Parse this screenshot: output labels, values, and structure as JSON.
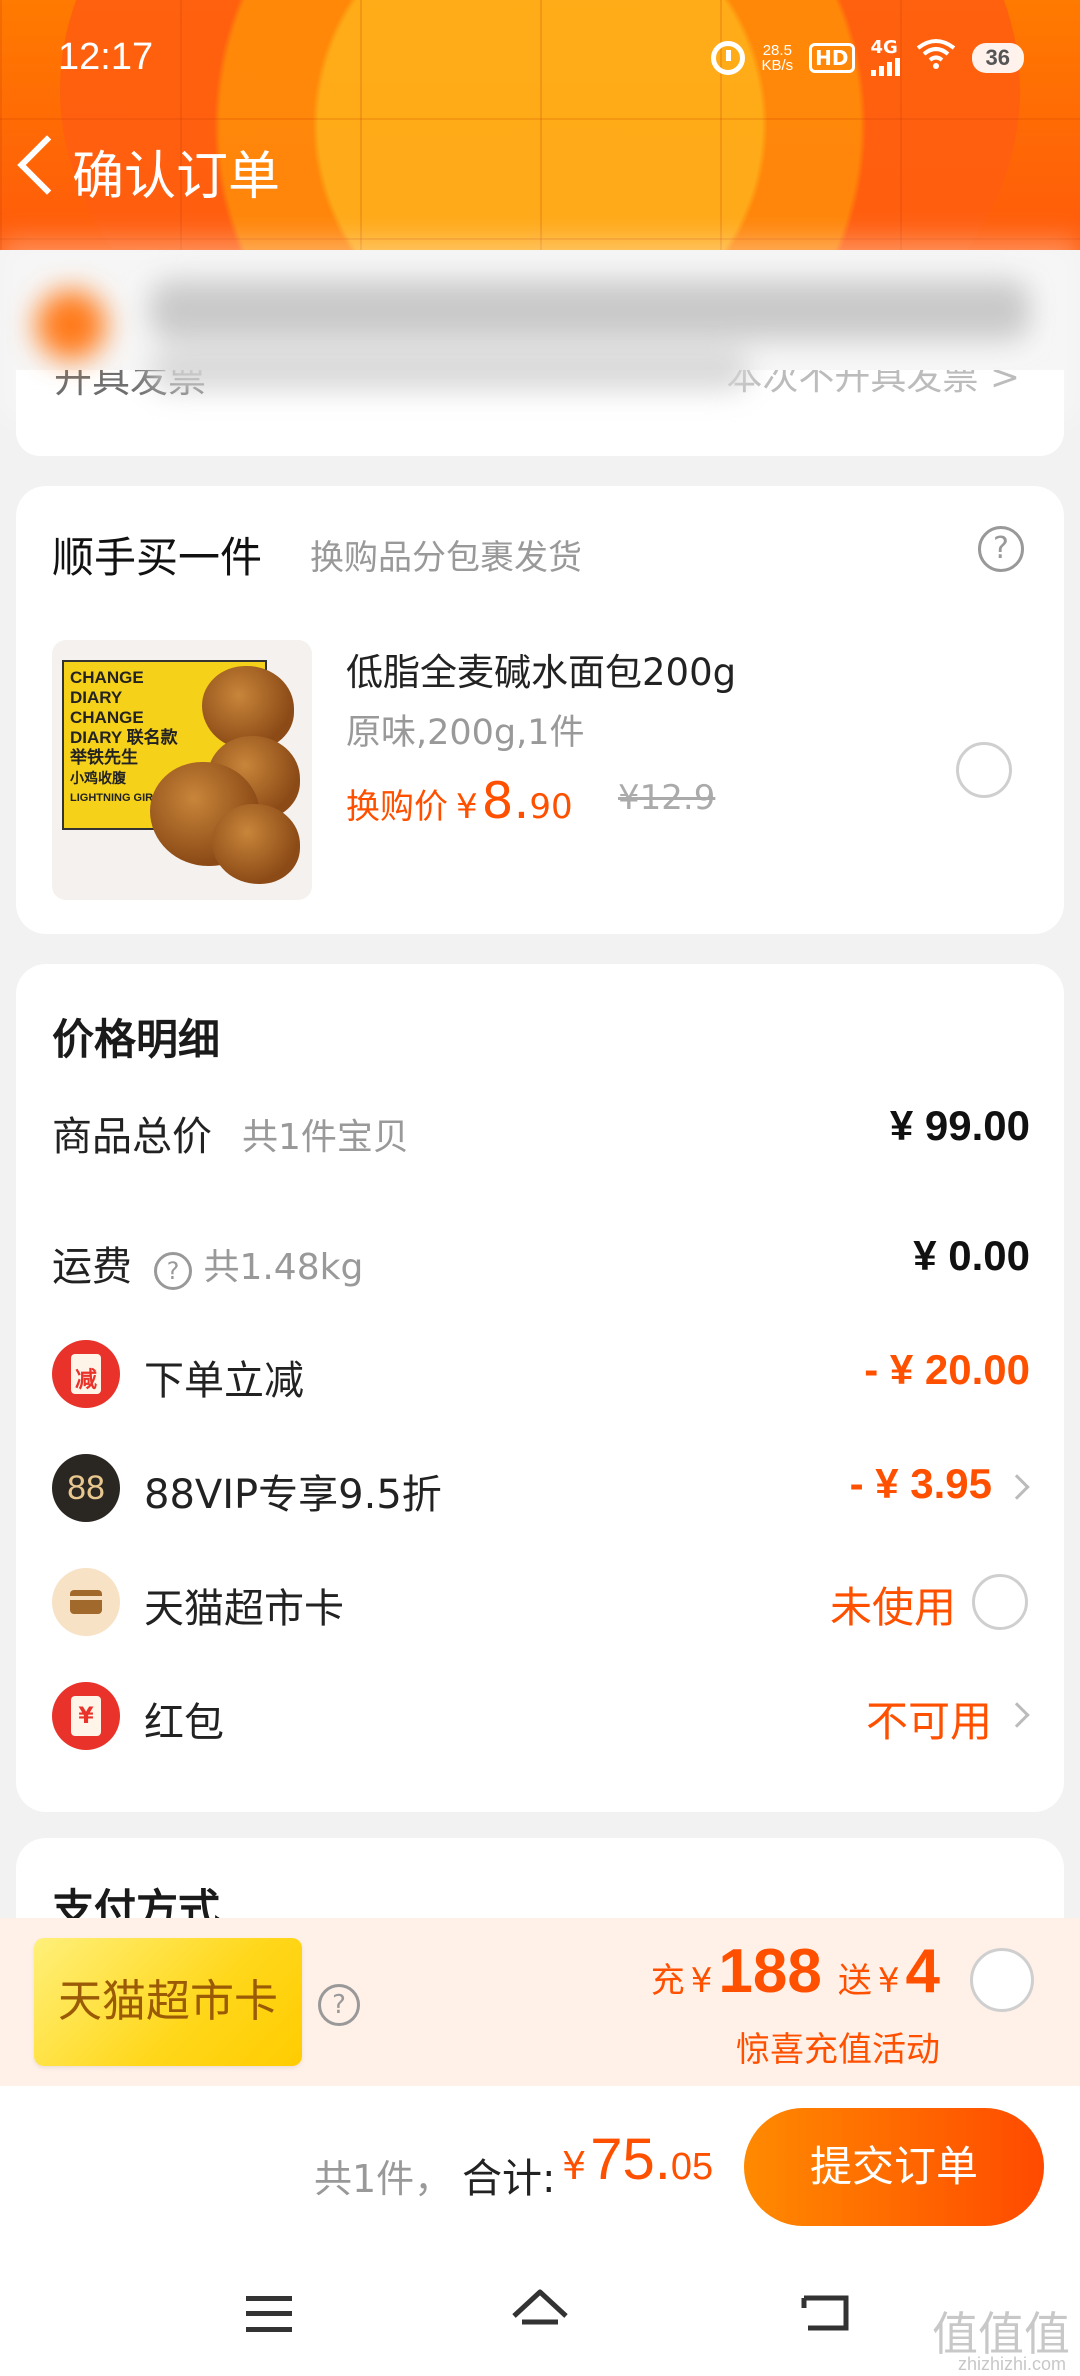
{
  "status_bar": {
    "time": "12:17",
    "net_speed_top": "28.5",
    "net_speed_unit": "KB/s",
    "hd": "HD",
    "network": "4G",
    "battery": "36"
  },
  "header": {
    "title": "确认订单",
    "bg_color": "#ff6a00"
  },
  "invoice": {
    "label": "开具发票",
    "value": "本次不开具发票 >"
  },
  "addon": {
    "title": "顺手买一件",
    "subtitle": "换购品分包裹发货",
    "product": {
      "package_lines": [
        "CHANGE",
        "DIARY",
        "CHANGE",
        "DIARY 联名款",
        "举铁先生",
        "小鸡收腹",
        "LIGHTNING GIRL"
      ],
      "name": "低脂全麦碱水面包200g",
      "spec": "原味,200g,1件",
      "price_label": "换购价",
      "currency": "¥",
      "price_int": "8.",
      "price_dec": "90",
      "original_price": "¥12.9",
      "selected": false
    }
  },
  "price_detail": {
    "title": "价格明细",
    "rows": [
      {
        "label": "商品总价",
        "note": "共1件宝贝",
        "amount": "¥ 99.00"
      },
      {
        "label": "运费",
        "note": "共1.48kg",
        "amount": "¥ 0.00"
      },
      {
        "label": "下单立减",
        "icon_text": "减",
        "amount": "- ¥ 20.00"
      },
      {
        "label": "88VIP专享9.5折",
        "icon_text": "88",
        "amount": "- ¥ 3.95"
      },
      {
        "label": "天猫超市卡",
        "amount": "未使用"
      },
      {
        "label": "红包",
        "icon_text": "¥",
        "amount": "不可用"
      }
    ],
    "accent_color": "#ff5000"
  },
  "payment": {
    "title": "支付方式"
  },
  "promo": {
    "card_label": "天猫超市卡",
    "recharge_prefix": "充",
    "currency": "¥",
    "recharge_amount": "188",
    "gift_prefix": "送",
    "gift_amount": "4",
    "subtitle": "惊喜充值活动"
  },
  "submit": {
    "count": "共1件，",
    "total_label": "合计:",
    "currency": "¥",
    "total_int": "75.",
    "total_dec": "05",
    "button": "提交订单"
  },
  "watermark": {
    "text": "值值值",
    "url": "zhizhizhi.com"
  }
}
